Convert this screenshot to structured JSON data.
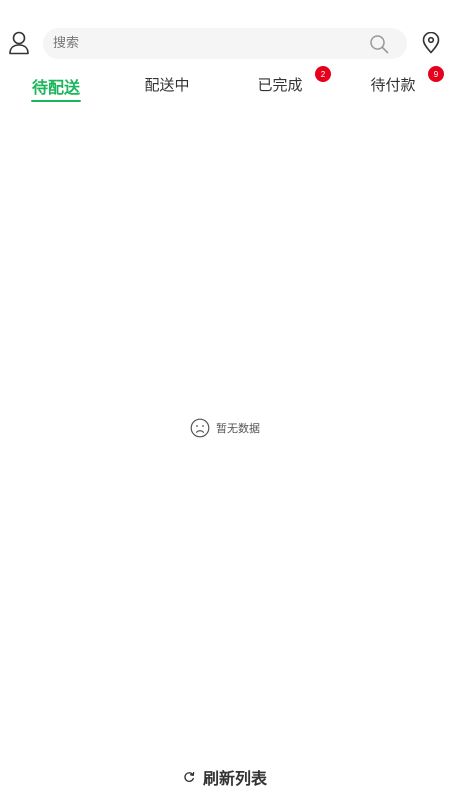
{
  "header": {
    "user_icon": "user-icon",
    "search_placeholder": "搜索",
    "search_icon": "search-icon",
    "location_icon": "location-pin-icon"
  },
  "tabs": [
    {
      "label": "待配送",
      "active": true,
      "badge": ""
    },
    {
      "label": "配送中",
      "active": false,
      "badge": ""
    },
    {
      "label": "已完成",
      "active": false,
      "badge": "2"
    },
    {
      "label": "待付款",
      "active": false,
      "badge": "9"
    }
  ],
  "empty_state": {
    "icon": "sad-face-icon",
    "text": "暂无数据"
  },
  "footer": {
    "refresh_icon": "refresh-icon",
    "refresh_label": "刷新列表"
  },
  "colors": {
    "accent": "#1bb55c",
    "badge": "#e5001b",
    "search_bg": "#f5f5f5",
    "text": "#333333"
  }
}
